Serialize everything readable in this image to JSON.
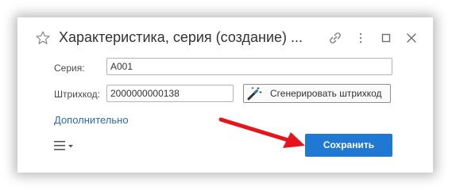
{
  "window": {
    "title": "Характеристика, серия (создание) ..."
  },
  "form": {
    "series_label": "Серия:",
    "series_value": "A001",
    "barcode_label": "Штрихкод:",
    "barcode_value": "2000000000138",
    "generate_label": "Сгенерировать штрихкод"
  },
  "links": {
    "more": "Дополнительно"
  },
  "actions": {
    "save_label": "Сохранить"
  },
  "icons": {
    "favorite": "star-icon",
    "link": "link-icon",
    "more": "more-vertical-icon",
    "maximize": "maximize-icon",
    "close": "close-icon",
    "generate": "magic-wand-icon",
    "menu": "hamburger-menu-icon",
    "annotation": "arrow-icon"
  },
  "colors": {
    "accent": "#1f78d1",
    "link": "#2c6ab0",
    "annotation_arrow": "#e8141c"
  }
}
